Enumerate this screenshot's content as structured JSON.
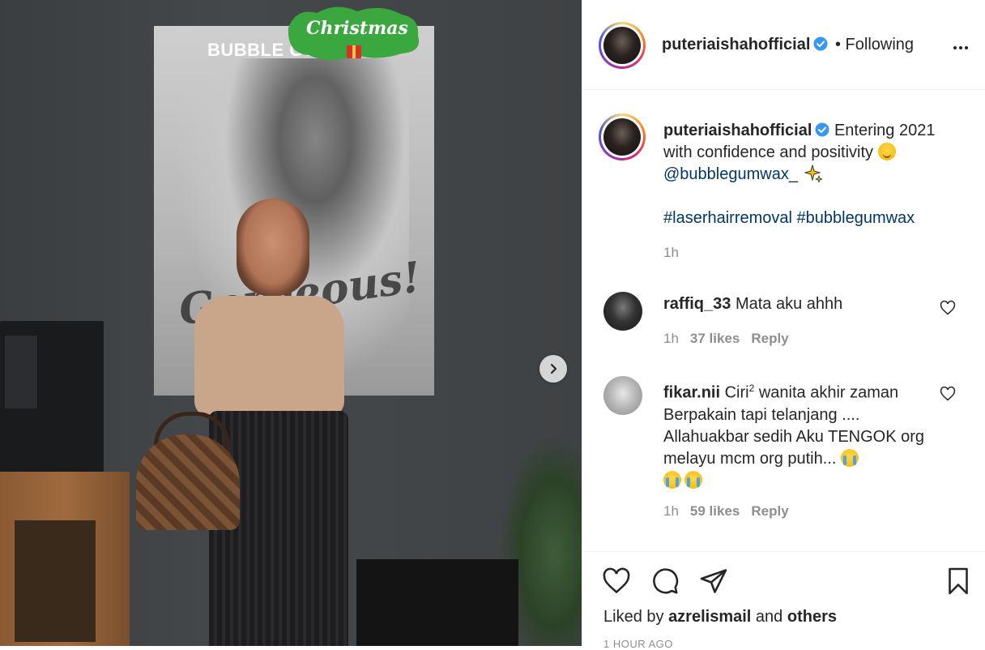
{
  "photo": {
    "poster_brand": "BUBBLE GUM",
    "poster_script": "Gorgeous!",
    "xmas_sign": "Christmas",
    "next_icon": "chevron-right-icon"
  },
  "header": {
    "username": "puteriaishahofficial",
    "follow_status": "• Following",
    "more_icon": "more-horizontal-icon"
  },
  "caption": {
    "username": "puteriaishahofficial",
    "text": "Entering 2021 with confidence and positivity",
    "mention": "@bubblegumwax_",
    "hashtags": "#laserhairremoval #bubblegumwax",
    "time": "1h"
  },
  "comments": [
    {
      "username": "raffiq_33",
      "text": "Mata aku ahhh",
      "time": "1h",
      "likes": "37 likes",
      "reply": "Reply"
    },
    {
      "username": "fikar.nii",
      "text_a": "Ciri",
      "sup": "2",
      "text_b": "wanita akhir zaman Berpakain tapi telanjang .... Allahuakbar sedih Aku TENGOK org melayu mcm org putih...",
      "time": "1h",
      "likes": "59 likes",
      "reply": "Reply"
    }
  ],
  "actions": {
    "liked_prefix": "Liked by",
    "liked_user": "azrelismail",
    "liked_and": "and",
    "liked_others": "others",
    "timestamp": "1 HOUR AGO"
  },
  "colors": {
    "link": "#00376b",
    "verified": "#3897f0",
    "secondary_text": "#8e8e8e"
  }
}
